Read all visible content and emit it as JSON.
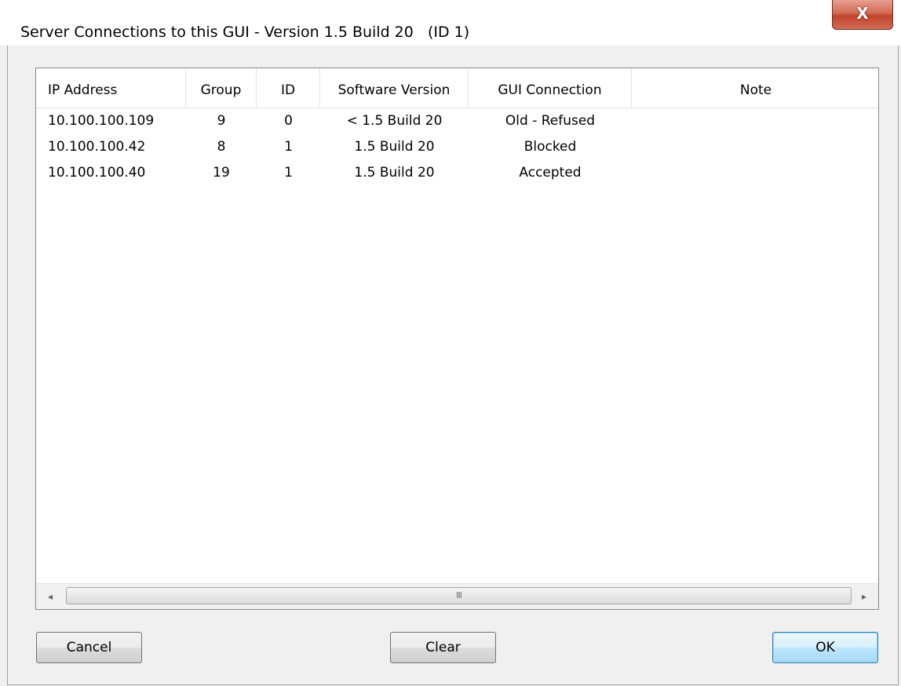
{
  "window": {
    "title": "Server Connections to this GUI - Version 1.5 Build 20   (ID 1)",
    "close_label": "X"
  },
  "table": {
    "columns": [
      "IP Address",
      "Group",
      "ID",
      "Software Version",
      "GUI Connection",
      "Note"
    ],
    "rows": [
      {
        "ip": "10.100.100.109",
        "group": "9",
        "id": "0",
        "software_version": "< 1.5 Build 20",
        "gui_connection": "Old - Refused",
        "note": ""
      },
      {
        "ip": "10.100.100.42",
        "group": "8",
        "id": "1",
        "software_version": "1.5 Build 20",
        "gui_connection": "Blocked",
        "note": ""
      },
      {
        "ip": "10.100.100.40",
        "group": "19",
        "id": "1",
        "software_version": "1.5 Build 20",
        "gui_connection": "Accepted",
        "note": ""
      }
    ]
  },
  "scrollbar": {
    "left_arrow": "◂",
    "right_arrow": "▸",
    "thumb_grip": "III"
  },
  "buttons": {
    "cancel": "Cancel",
    "clear": "Clear",
    "ok": "OK"
  }
}
